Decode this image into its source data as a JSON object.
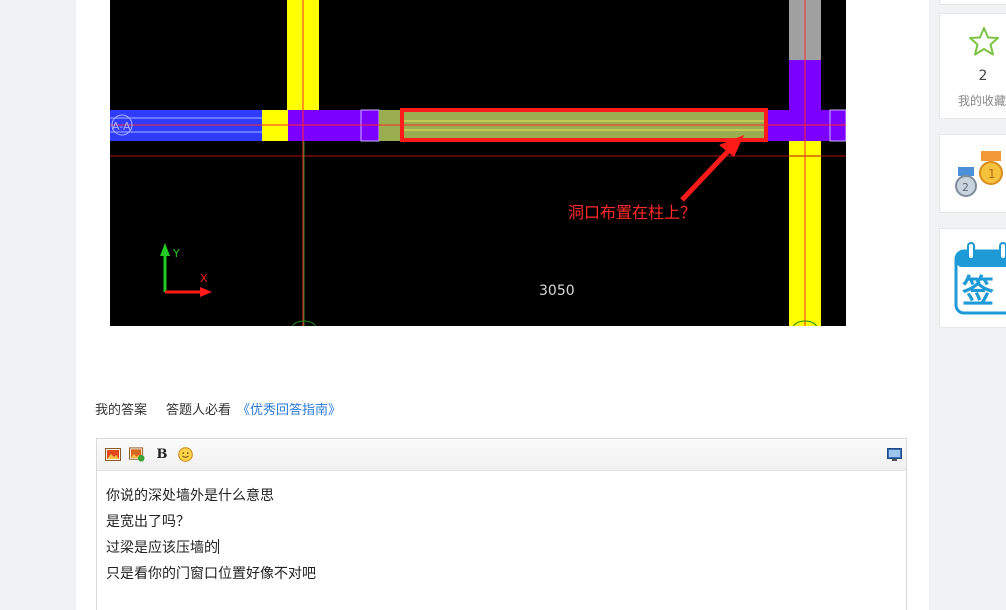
{
  "cad": {
    "annotation": "洞口布置在柱上？",
    "dimension": "3050",
    "axis_y": "Y",
    "axis_x": "X",
    "grid_label": "A-A",
    "colors": {
      "wall": "#7b00ff",
      "column": "#ffff00",
      "beam": "#2f3cff",
      "highlight": "#ff1a1a",
      "opening": "#9aad4f"
    }
  },
  "answer_bar": {
    "my_answer": "我的答案",
    "must_read": "答题人必看",
    "guide_link": "《优秀回答指南》"
  },
  "editor": {
    "toolbar": {
      "image_icon": "image-icon",
      "gallery_icon": "image-add-icon",
      "bold": "B",
      "emoji_icon": "emoji-icon",
      "fullscreen_icon": "monitor-icon"
    },
    "lines": [
      "你说的深处墙外是什么意思",
      "是宽出了吗？",
      "过梁是应该压墙的",
      "只是看你的门窗口位置好像不对吧"
    ]
  },
  "sidebar": {
    "favorites_count": "2",
    "favorites_label": "我的收藏",
    "badges_icon": "medal-icon",
    "checkin_text": "签"
  }
}
